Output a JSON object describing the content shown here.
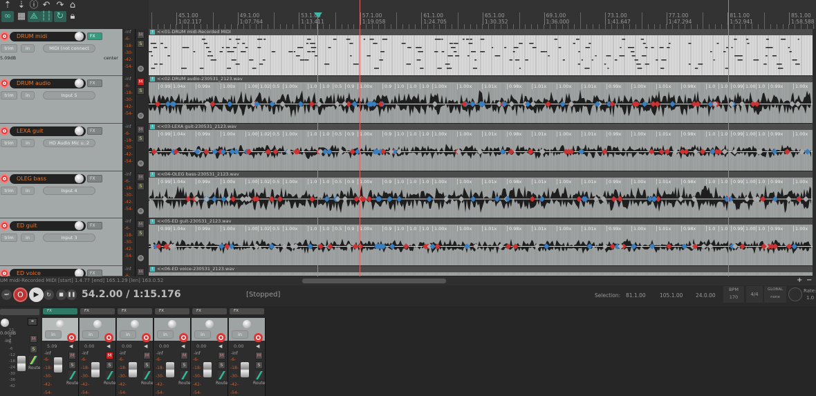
{
  "toolbar": {
    "icons": [
      "save-icon",
      "export-icon",
      "info-icon",
      "undo-icon",
      "redo-icon",
      "metronome-icon",
      "link-icon",
      "grid-icon",
      "envelope-icon",
      "snap-icon",
      "loop-icon",
      "lock-icon"
    ]
  },
  "ruler": {
    "markers": [
      {
        "bar": "45.1.00",
        "time": "1:02.117"
      },
      {
        "bar": "49.1.00",
        "time": "1:07.764"
      },
      {
        "bar": "53.1.00",
        "time": "1:13.411"
      },
      {
        "bar": "57.1.00",
        "time": "1:19.058"
      },
      {
        "bar": "61.1.00",
        "time": "1:24.705"
      },
      {
        "bar": "65.1.00",
        "time": "1:30.352"
      },
      {
        "bar": "69.1.00",
        "time": "1:36.000"
      },
      {
        "bar": "73.1.00",
        "time": "1:41.647"
      },
      {
        "bar": "77.1.00",
        "time": "1:47.294"
      },
      {
        "bar": "81.1.00",
        "time": "1:52.941"
      },
      {
        "bar": "85.1.00",
        "time": "1:58.588"
      }
    ]
  },
  "tracks": [
    {
      "name": "DRUM midi",
      "input": "MIDI (not connect",
      "volume": "5.09dB",
      "pan": "center",
      "item": "<<01-DRUM midi-Recorded MIDI",
      "muted": false,
      "fx_active": true,
      "type": "midi"
    },
    {
      "name": "DRUM audio",
      "input": "Input 5",
      "item": "<<02-DRUM audio-230531_2123.wav",
      "muted": true,
      "type": "audio"
    },
    {
      "name": "LEXA guit",
      "input": "HD Audio Mic u..2",
      "item": "<<03-LEXA guit-230531_2123.wav",
      "muted": false,
      "type": "audio"
    },
    {
      "name": "OLEG bass",
      "input": "Input 4",
      "item": "<<04-OLEG bass-230531_2123.wav",
      "muted": false,
      "type": "audio"
    },
    {
      "name": "ED guit",
      "input": "Input 3",
      "item": "<<05-ED guit-230531_2123.wav",
      "muted": false,
      "type": "audio"
    },
    {
      "name": "ED voice",
      "input": "",
      "item": "<<06-ED voice-230531_2123.wav",
      "muted": false,
      "type": "audio"
    }
  ],
  "track_controls": {
    "trim": "trim",
    "in": "in",
    "fx": "FX",
    "mute": "M",
    "solo": "S",
    "meter_scale": [
      "-inf",
      "-6-",
      "-18-",
      "-30-",
      "-42-",
      "-54-"
    ]
  },
  "stretch_labels": [
    "0.99",
    "1.04x",
    "0.99x",
    "1.00x",
    "1.00",
    "1.02",
    "0.5",
    "1.00x",
    "1.0",
    "1.0",
    "0.5",
    "0.9",
    "1.00x",
    "0.9",
    "1.0",
    "1.0",
    "1.0",
    "1.00x",
    "1.00x",
    "1.01x",
    "0.98x",
    "1.01x",
    "1.00x",
    "1.01x",
    "0.99x",
    "1.00x",
    "1.01x",
    "0.98x",
    "1.0",
    "1.0",
    "0.99",
    "1.00",
    "1.0",
    "0.99x",
    "1.00x",
    "1.00x",
    "1.00x"
  ],
  "status_line": "UM midi-Recorded MIDI [start] 1.4.77 [end] 165.1.29 [len] 163.0.52",
  "transport": {
    "position": "54.2.00 / 1:15.176",
    "state": "[Stopped]",
    "selection_label": "Selection:",
    "sel_start": "81.1.00",
    "sel_end": "105.1.00",
    "sel_len": "24.0.00",
    "bpm_label": "BPM",
    "bpm": "170",
    "timesig": "4/4",
    "global_label": "GLOBAL",
    "global_value": "none",
    "rate_label": "Rate:",
    "rate": "1.0"
  },
  "mixer": {
    "master_volume": "0.00dB",
    "master_peak": "-inf",
    "master_scale": [
      "12",
      "6",
      "0",
      "-6",
      "-12",
      "-18",
      "-24",
      "-30",
      "-36",
      "-42"
    ],
    "strips": [
      {
        "volume": "5.09",
        "muted": false,
        "fx_active": true
      },
      {
        "volume": "0.00",
        "muted": true
      },
      {
        "volume": "0.00",
        "muted": false
      },
      {
        "volume": "0.00",
        "muted": false
      },
      {
        "volume": "0.00",
        "muted": false
      },
      {
        "volume": "0.00",
        "muted": false
      }
    ],
    "route": "Route",
    "fx": "FX",
    "in": "in",
    "mute": "M",
    "solo": "S",
    "peak": "-inf",
    "scale": [
      "-6-",
      "-18-",
      "-30-",
      "-42-",
      "-54-"
    ]
  },
  "colors": {
    "accent": "#3a9a80",
    "record": "#dd3333",
    "track_name": "#e8782c",
    "meter": "#e05a20",
    "selection_edge": "#e06a6a",
    "playhead": "#3fb8a8"
  }
}
